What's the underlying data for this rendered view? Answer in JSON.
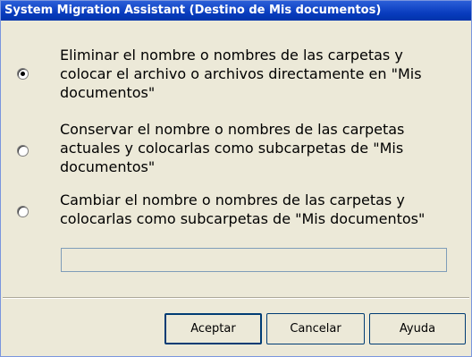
{
  "window": {
    "title": "System Migration Assistant (Destino de Mis documentos)"
  },
  "options": [
    {
      "label": "Eliminar el nombre o nombres de las carpetas y colocar el archivo o archivos directamente en \"Mis documentos\"",
      "selected": true
    },
    {
      "label": "Conservar el nombre o nombres de las carpetas actuales y colocarlas como subcarpetas de \"Mis documentos\"",
      "selected": false
    },
    {
      "label": "Cambiar el nombre o nombres de las carpetas y colocarlas como subcarpetas de \"Mis documentos\"",
      "selected": false
    }
  ],
  "folder_name_field": {
    "value": ""
  },
  "buttons": {
    "accept": "Aceptar",
    "cancel": "Cancelar",
    "help": "Ayuda"
  }
}
